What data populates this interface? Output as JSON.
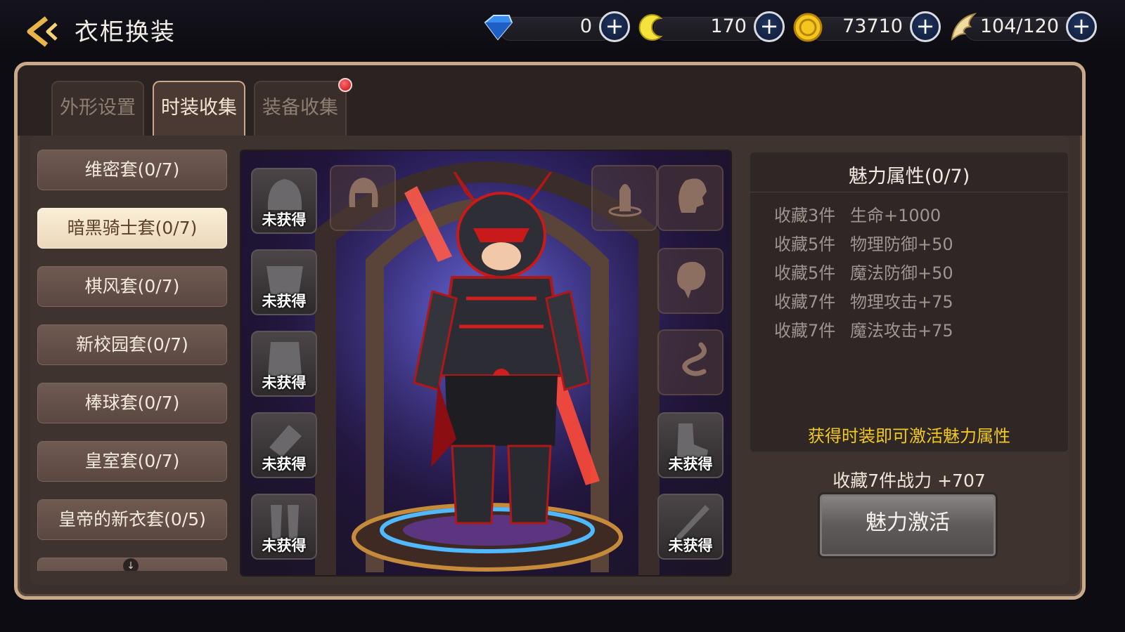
{
  "header": {
    "title": "衣柜换装",
    "resources": [
      {
        "icon": "diamond-icon",
        "value": "0"
      },
      {
        "icon": "crescent-currency-icon",
        "value": "170"
      },
      {
        "icon": "gold-coin-icon",
        "value": "73710"
      },
      {
        "icon": "wing-stamina-icon",
        "value": "104/120"
      }
    ]
  },
  "tabs": [
    {
      "label": "外形设置",
      "active": false
    },
    {
      "label": "时装收集",
      "active": true
    },
    {
      "label": "装备收集",
      "active": false,
      "badge": true
    }
  ],
  "sets": [
    {
      "label": "维密套(0/7)"
    },
    {
      "label": "暗黑骑士套(0/7)",
      "selected": true
    },
    {
      "label": "棋风套(0/7)"
    },
    {
      "label": "新校园套(0/7)"
    },
    {
      "label": "棒球套(0/7)"
    },
    {
      "label": "皇室套(0/7)"
    },
    {
      "label": "皇帝的新衣套(0/5)"
    }
  ],
  "slots": {
    "left": [
      {
        "label": "未获得",
        "icon": "helmet-icon"
      },
      {
        "label": "未获得",
        "icon": "chest-armor-icon"
      },
      {
        "label": "未获得",
        "icon": "body-armor-icon"
      },
      {
        "label": "未获得",
        "icon": "gauntlet-icon"
      },
      {
        "label": "未获得",
        "icon": "leg-armor-icon"
      }
    ],
    "right": [
      {
        "label": "未获得",
        "icon": "boots-icon"
      },
      {
        "label": "未获得",
        "icon": "sword-icon"
      }
    ]
  },
  "charm": {
    "title": "魅力属性(0/7)",
    "rows": [
      {
        "count": "收藏3件",
        "effect": "生命+1000"
      },
      {
        "count": "收藏5件",
        "effect": "物理防御+50"
      },
      {
        "count": "收藏5件",
        "effect": "魔法防御+50"
      },
      {
        "count": "收藏7件",
        "effect": "物理攻击+75"
      },
      {
        "count": "收藏7件",
        "effect": "魔法攻击+75"
      }
    ],
    "hint": "获得时装即可激活魅力属性",
    "power": "收藏7件战力 +707",
    "button": "魅力激活"
  }
}
